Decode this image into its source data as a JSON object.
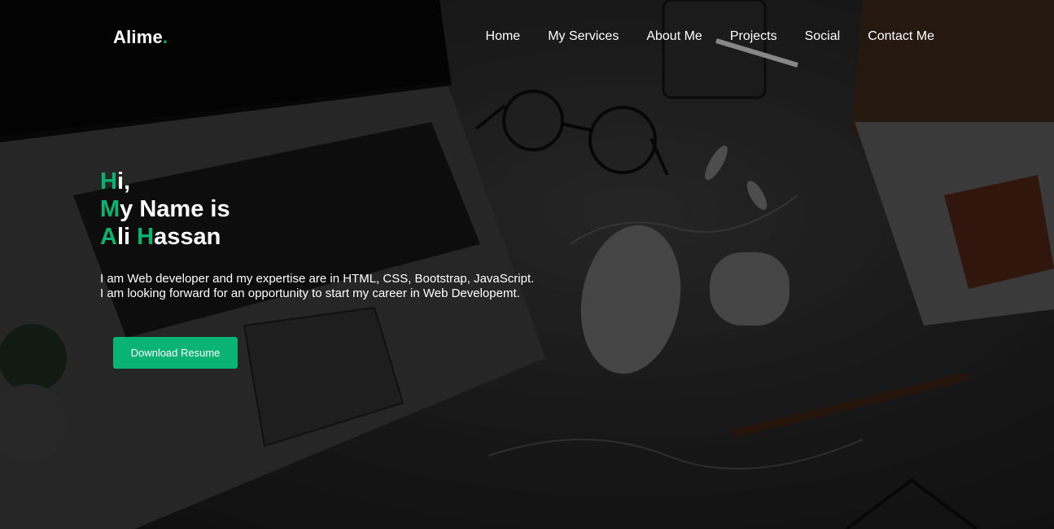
{
  "brand": {
    "name": "Alime",
    "dot": "."
  },
  "nav": [
    {
      "label": "Home"
    },
    {
      "label": "My Services"
    },
    {
      "label": "About Me"
    },
    {
      "label": "Projects"
    },
    {
      "label": "Social"
    },
    {
      "label": "Contact Me"
    }
  ],
  "hero": {
    "line1": {
      "accent": "H",
      "rest": "i,"
    },
    "line2": {
      "accent": "M",
      "rest": "y Name is"
    },
    "line3": {
      "accent1": "A",
      "mid": "li ",
      "accent2": "H",
      "rest": "assan"
    },
    "intro_line1": "I am Web developer and my expertise are in HTML, CSS, Bootstrap, JavaScript.",
    "intro_line2": "I am looking forward for an opportunity to start my career in Web Developemt.",
    "button_label": "Download Resume"
  },
  "colors": {
    "accent": "#08b374",
    "text": "#ffffff",
    "background": "#1b1b1b"
  }
}
